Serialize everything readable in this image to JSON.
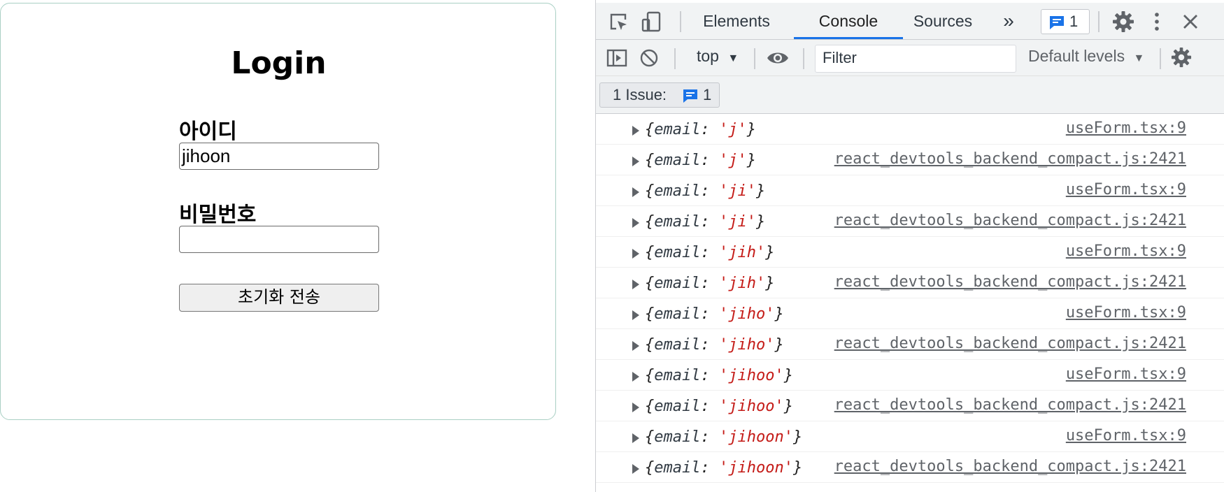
{
  "login": {
    "title": "Login",
    "id_label": "아이디",
    "id_value": "jihoon",
    "password_label": "비밀번호",
    "password_value": "",
    "button_label": "초기화 전송"
  },
  "devtools": {
    "tabs": [
      "Elements",
      "Console",
      "Sources"
    ],
    "active_tab": "Console",
    "more_tabs": "»",
    "issues_count": "1",
    "context": "top",
    "filter_placeholder": "Filter",
    "levels": "Default levels",
    "issue_bar_label": "1 Issue:",
    "issue_bar_count": "1",
    "messages": [
      {
        "key": "email",
        "value": "'j'",
        "source": "useForm.tsx:9"
      },
      {
        "key": "email",
        "value": "'j'",
        "source": "react_devtools_backend_compact.js:2421"
      },
      {
        "key": "email",
        "value": "'ji'",
        "source": "useForm.tsx:9"
      },
      {
        "key": "email",
        "value": "'ji'",
        "source": "react_devtools_backend_compact.js:2421"
      },
      {
        "key": "email",
        "value": "'jih'",
        "source": "useForm.tsx:9"
      },
      {
        "key": "email",
        "value": "'jih'",
        "source": "react_devtools_backend_compact.js:2421"
      },
      {
        "key": "email",
        "value": "'jiho'",
        "source": "useForm.tsx:9"
      },
      {
        "key": "email",
        "value": "'jiho'",
        "source": "react_devtools_backend_compact.js:2421"
      },
      {
        "key": "email",
        "value": "'jihoo'",
        "source": "useForm.tsx:9"
      },
      {
        "key": "email",
        "value": "'jihoo'",
        "source": "react_devtools_backend_compact.js:2421"
      },
      {
        "key": "email",
        "value": "'jihoon'",
        "source": "useForm.tsx:9"
      },
      {
        "key": "email",
        "value": "'jihoon'",
        "source": "react_devtools_backend_compact.js:2421"
      }
    ],
    "colors": {
      "accent": "#1a73e8",
      "string": "#c41a16",
      "toolbar": "#f1f3f4"
    }
  }
}
